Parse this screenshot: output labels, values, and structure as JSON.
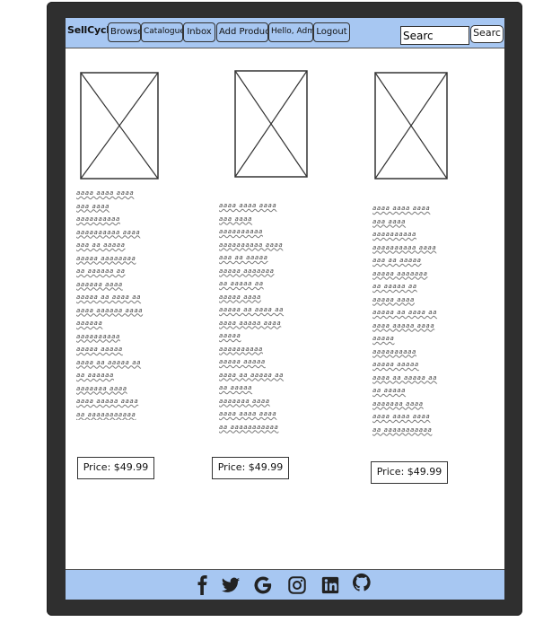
{
  "navbar": {
    "brand": "SellCycle",
    "items": [
      {
        "label": "Browse"
      },
      {
        "label": "Catalogue"
      },
      {
        "label": "Inbox"
      },
      {
        "label": "Add Product"
      },
      {
        "label": "Hello, Admin"
      },
      {
        "label": "Logout"
      }
    ],
    "search": {
      "value": "Searc",
      "button_label": "Searc"
    }
  },
  "products": [
    {
      "description": "aaaa aaaa aaaa\naaa aaaa\naaaaaaaaaa\naaaaaaaaaa aaaa\naaa aa aaaaa\naaaaa aaaaaaaa\naa aaaaaa aa\naaaaaa aaaa\naaaaa aa aaaa aa\naaaa aaaaaa aaaa\naaaaaa\naaaaaaaaaa\naaaaa aaaaa\naaaa aa aaaaa aa\naa aaaaaa\naaaaaaa aaaa\naaaa aaaaa aaaa\naa aaaaaaaaaaa",
      "price": "Price: $49.99"
    },
    {
      "description": "aaaa aaaa aaaa\naaa aaaa\naaaaaaaaaa\naaaaaaaaaa aaaa\naaa aa aaaaa\naaaaa aaaaaaa\naa aaaaa aa\naaaaa aaaa\naaaaa aa aaaa aa\naaaa aaaaa aaaa\naaaaa\naaaaaaaaaa\naaaaa aaaaa\naaaa aa aaaaa aa\naa aaaaa\naaaaaaa aaaa\naaaa aaaa aaaa\naa aaaaaaaaaaa",
      "price": "Price: $49.99"
    },
    {
      "description": "aaaa aaaa aaaa\naaa aaaa\naaaaaaaaaa\naaaaaaaaaa aaaa\naaa aa aaaaa\naaaaa aaaaaaa\naa aaaaa aa\naaaaa aaaa\naaaaa aa aaaa aa\naaaa aaaaa aaaa\naaaaa\naaaaaaaaaa\naaaaa aaaaa\naaaa aa aaaaa aa\naa aaaaa\naaaaaaa aaaa\naaaa aaaa aaaa\naa aaaaaaaaaaa",
      "price": "Price: $49.99"
    }
  ],
  "footer": {
    "icons": [
      "facebook-icon",
      "twitter-icon",
      "google-icon",
      "instagram-icon",
      "linkedin-icon",
      "github-icon"
    ]
  },
  "colors": {
    "bar": "#a7c7f2",
    "frame": "#2f2f2f"
  }
}
